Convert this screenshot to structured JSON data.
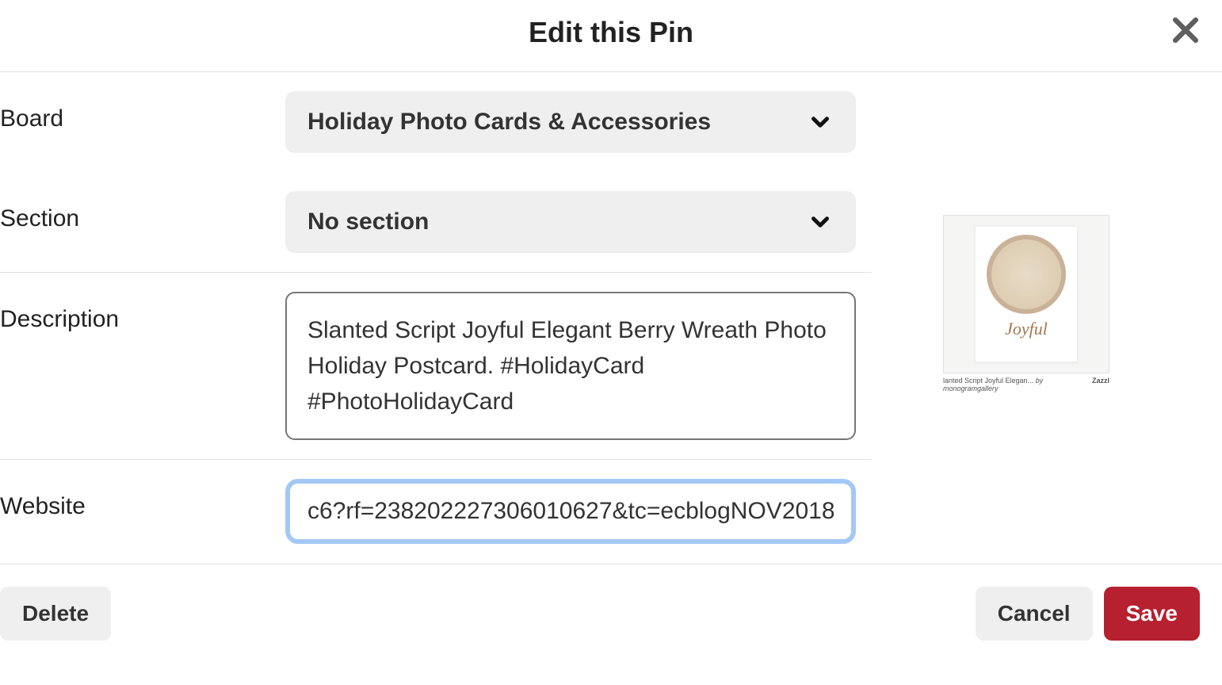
{
  "header": {
    "title": "Edit this Pin"
  },
  "form": {
    "board": {
      "label": "Board",
      "value": "Holiday Photo Cards & Accessories"
    },
    "section": {
      "label": "Section",
      "value": "No section"
    },
    "description": {
      "label": "Description",
      "value": "Slanted Script Joyful Elegant Berry Wreath Photo Holiday Postcard. #HolidayCard #PhotoHolidayCard"
    },
    "website": {
      "label": "Website",
      "value": "c6?rf=238202227306010627&tc=ecblogNOV2018"
    }
  },
  "preview": {
    "script_word": "Joyful",
    "caption_left": "lanted Script Joyful Elegan...",
    "caption_by": "by monogramgallery",
    "brand": "Zazzl"
  },
  "footer": {
    "delete_label": "Delete",
    "cancel_label": "Cancel",
    "save_label": "Save"
  }
}
